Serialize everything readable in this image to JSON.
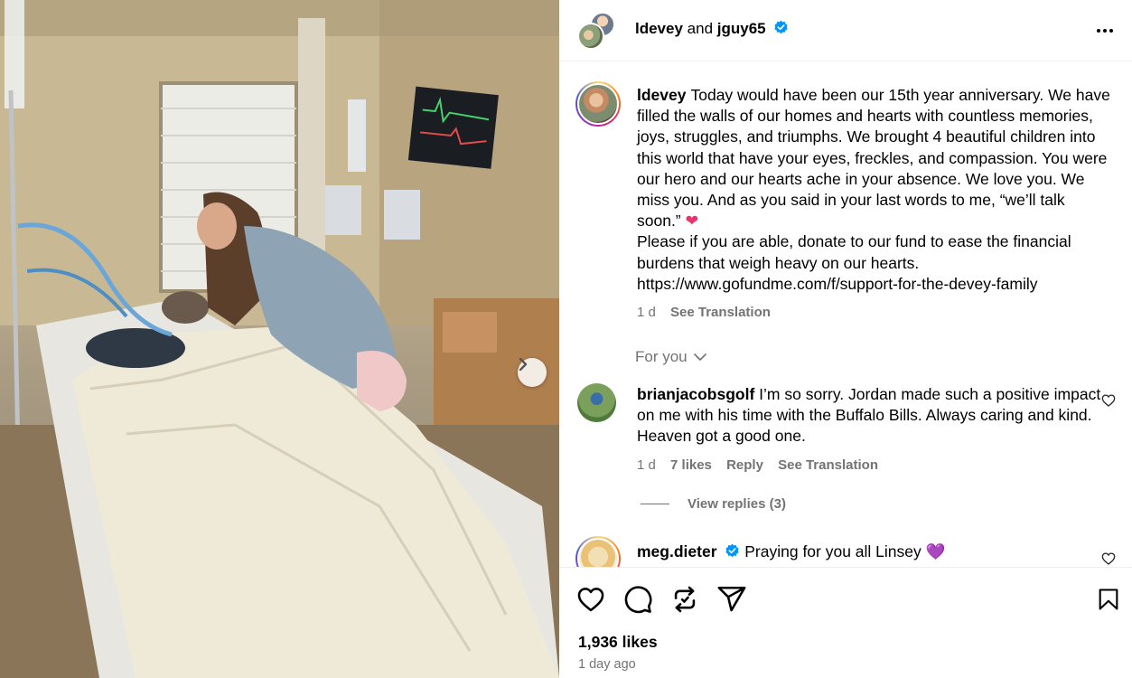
{
  "header": {
    "user1": "ldevey",
    "joiner": "and",
    "user2": "jguy65"
  },
  "caption": {
    "username": "ldevey",
    "text": "Today would have been our 15th year anniversary. We have filled the walls of our homes and hearts with countless memories, joys, struggles, and triumphs. We brought 4 beautiful children into this world that have your eyes, freckles, and compassion. You were our hero and our hearts ache in your absence. We love you. We miss you. And as you said in your last words to me, “we’ll talk soon.”",
    "emoji": "❤",
    "text2": "Please if you are able, donate to our fund to ease the financial burdens that weigh heavy on our hearts.",
    "link": "https://www.gofundme.com/f/support-for-the-devey-family",
    "time": "1 d",
    "see_translation": "See Translation"
  },
  "for_you": "For you",
  "comments": [
    {
      "username": "brianjacobsgolf",
      "text": "I’m so sorry. Jordan made such a positive impact on me with his time with the Buffalo Bills. Always caring and kind. Heaven got a good one.",
      "time": "1 d",
      "likes": "7 likes",
      "reply": "Reply",
      "see_translation": "See Translation",
      "view_replies": "View replies (3)"
    },
    {
      "username": "meg.dieter",
      "text": "Praying for you all Linsey",
      "emoji": "💜"
    }
  ],
  "footer": {
    "likes": "1,936 likes",
    "ago": "1 day ago"
  },
  "colors": {
    "verified": "#0095f6",
    "secondary_text": "#737373",
    "heart_emoji": "#e8336d"
  },
  "icons": [
    "more-options-icon",
    "verified-badge-icon",
    "chevron-down-icon",
    "heart-icon",
    "comment-icon",
    "repost-icon",
    "share-icon",
    "bookmark-icon",
    "next-image-icon"
  ]
}
